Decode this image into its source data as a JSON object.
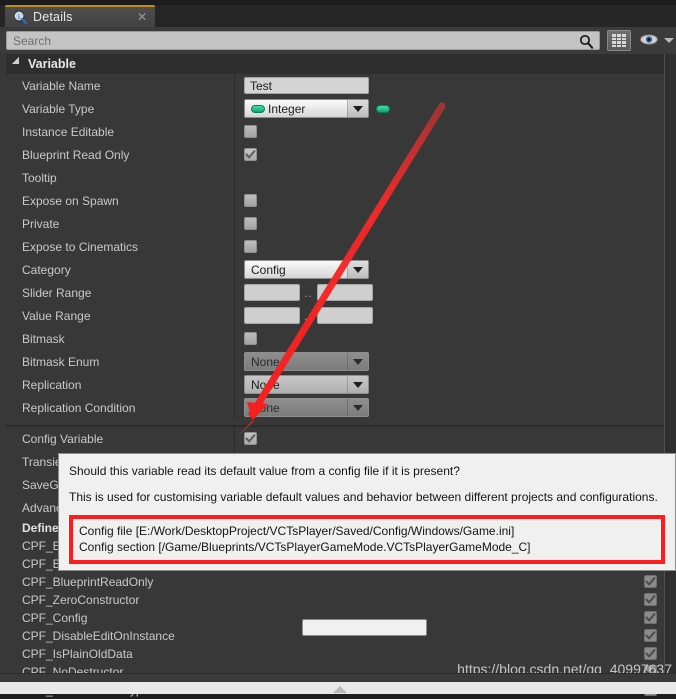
{
  "window": {
    "tab_title": "Details",
    "tab_icon": "details-info-icon",
    "close_icon": "close-icon"
  },
  "search": {
    "placeholder": "Search",
    "search_icon": "search-icon",
    "grid_button_icon": "grid-view-icon",
    "eye_icon": "visibility-eye-icon",
    "eye_caret_icon": "chevron-down-icon"
  },
  "section": {
    "title": "Variable",
    "expander_icon": "triangle-expanded-icon"
  },
  "properties": [
    {
      "label": "Variable Name",
      "type": "text",
      "value": "Test"
    },
    {
      "label": "Variable Type",
      "type": "type",
      "value": "Integer"
    },
    {
      "label": "Instance Editable",
      "type": "checkbox",
      "checked": false
    },
    {
      "label": "Blueprint Read Only",
      "type": "checkbox",
      "checked": true
    },
    {
      "label": "Tooltip",
      "type": "text",
      "value": ""
    },
    {
      "label": "Expose on Spawn",
      "type": "checkbox",
      "checked": false
    },
    {
      "label": "Private",
      "type": "checkbox",
      "checked": false
    },
    {
      "label": "Expose to Cinematics",
      "type": "checkbox",
      "checked": false
    },
    {
      "label": "Category",
      "type": "dropdown",
      "value": "Config",
      "style": "light"
    },
    {
      "label": "Slider Range",
      "type": "range",
      "min": "",
      "max": ""
    },
    {
      "label": "Value Range",
      "type": "range",
      "min": "",
      "max": ""
    },
    {
      "label": "Bitmask",
      "type": "checkbox",
      "checked": false
    },
    {
      "label": "Bitmask Enum",
      "type": "dropdown",
      "value": "None",
      "style": "dark"
    },
    {
      "label": "Replication",
      "type": "dropdown",
      "value": "None",
      "style": "mid"
    },
    {
      "label": "Replication Condition",
      "type": "dropdown",
      "value": "None",
      "style": "dark"
    }
  ],
  "config_row": {
    "label": "Config Variable",
    "checked": true
  },
  "hidden_rows": [
    {
      "label": "Transient"
    },
    {
      "label": "SaveGame"
    },
    {
      "label": "Advanced"
    }
  ],
  "flags": {
    "header": "Defined",
    "items": [
      {
        "label": "CPF_Edit",
        "checked": true
      },
      {
        "label": "CPF_BlueprintVisible",
        "checked": true
      },
      {
        "label": "CPF_BlueprintReadOnly",
        "checked": true
      },
      {
        "label": "CPF_ZeroConstructor",
        "checked": true
      },
      {
        "label": "CPF_Config",
        "checked": true
      },
      {
        "label": "CPF_DisableEditOnInstance",
        "checked": true
      },
      {
        "label": "CPF_IsPlainOldData",
        "checked": true
      },
      {
        "label": "CPF_NoDestructor",
        "checked": true
      },
      {
        "label": "CPF_HasGetValueTypeHash",
        "checked": true
      }
    ]
  },
  "tooltip": {
    "line1": "Should this variable read its default value from a config file if it is present?",
    "line2": "This is used for customising variable default values and behavior between different projects and configurations.",
    "highlight_line1": "Config file [E:/Work/DesktopProject/VCTsPlayer/Saved/Config/Windows/Game.ini]",
    "highlight_line2": "Config section [/Game/Blueprints/VCTsPlayerGameMode.VCTsPlayerGameMode_C]",
    "highlight_color": "#ff1c1c"
  },
  "annotation": {
    "arrow_color": "#f23030",
    "arrow_name": "red-pointer-arrow"
  },
  "watermark": {
    "text": "https://blog.csdn.net/qq_40997637"
  },
  "footer": {
    "scroll_up_icon": "scroll-up-triangle-icon"
  }
}
